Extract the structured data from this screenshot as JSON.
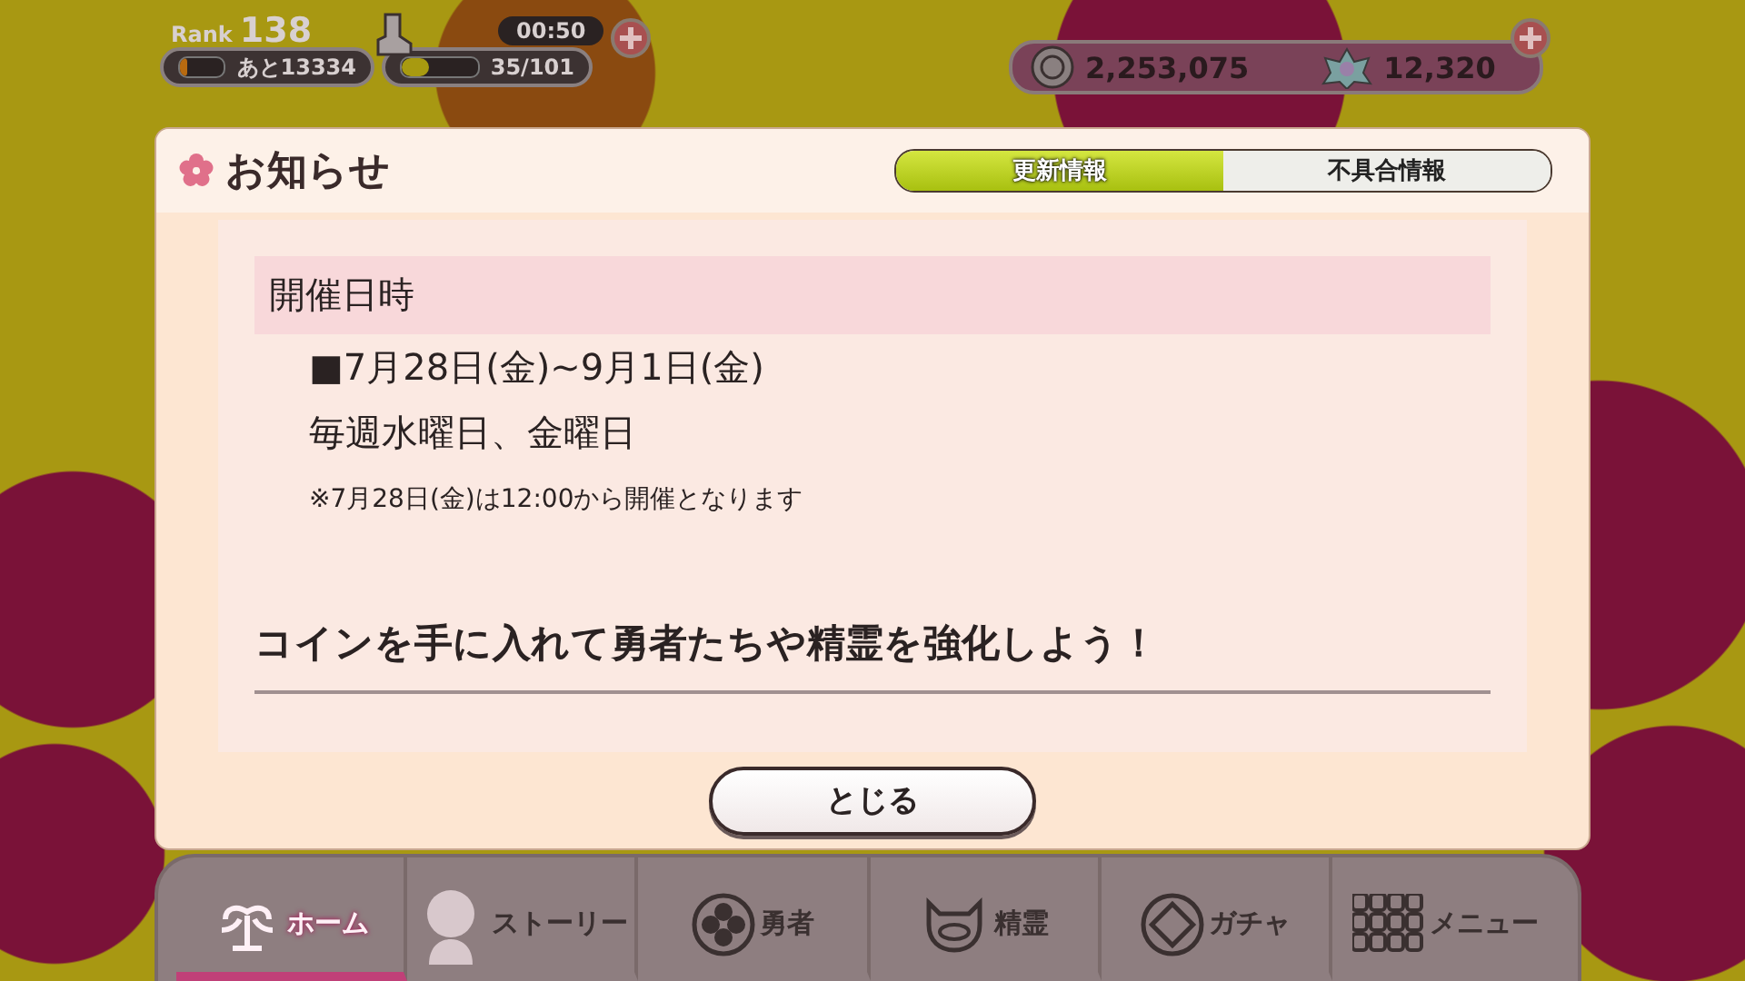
{
  "hud": {
    "rank_label": "Rank",
    "rank": "138",
    "exp_remaining": "あと13334",
    "exp_bar": {
      "level": 0.15
    },
    "stamina_timer": "00:50",
    "stamina": "35/101",
    "stamina_bar": {
      "level": 0.35
    },
    "coins": "2,253,075",
    "gems": "12,320"
  },
  "dialog": {
    "title": "お知らせ",
    "tabs": [
      {
        "label": "更新情報",
        "selected": true
      },
      {
        "label": "不具合情報",
        "selected": false
      }
    ],
    "section_heading": "開催日時",
    "schedule": [
      "■7月28日(金)~9月1日(金)",
      "毎週水曜日、金曜日"
    ],
    "note": "※7月28日(金)は12:00から開催となります",
    "message": "コインを手に入れて勇者たちや精霊を強化しよう！",
    "close_button": "とじる"
  },
  "nav": [
    {
      "label": "ホーム",
      "kind": "home",
      "selected": true
    },
    {
      "label": "ストーリー",
      "kind": "story",
      "selected": false
    },
    {
      "label": "勇者",
      "kind": "hero",
      "selected": false
    },
    {
      "label": "精霊",
      "kind": "spirit",
      "selected": false
    },
    {
      "label": "ガチャ",
      "kind": "gacha",
      "selected": false
    },
    {
      "label": "メニュー",
      "kind": "menu",
      "selected": false
    }
  ]
}
